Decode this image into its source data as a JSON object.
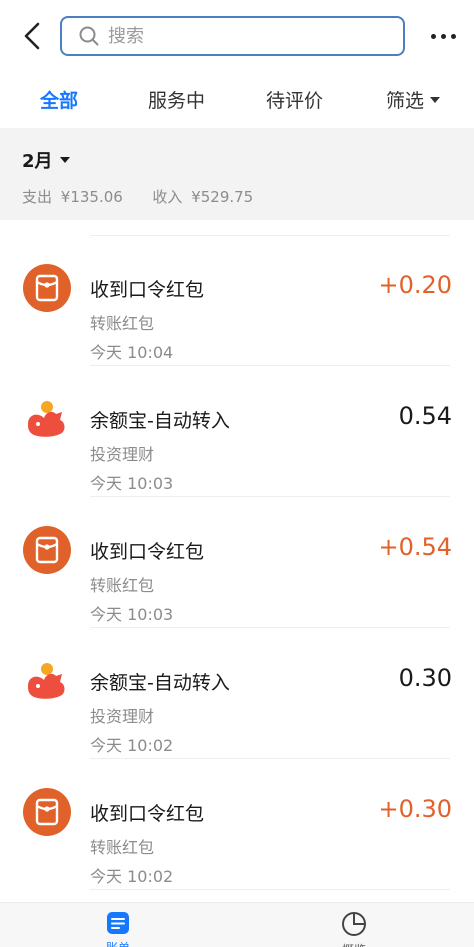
{
  "header": {
    "search_placeholder": "搜索"
  },
  "tabs": [
    {
      "label": "全部",
      "active": true
    },
    {
      "label": "服务中",
      "active": false
    },
    {
      "label": "待评价",
      "active": false
    },
    {
      "label": "筛选",
      "active": false
    }
  ],
  "summary": {
    "month": "2月",
    "expense_label": "支出",
    "expense_value": "¥135.06",
    "income_label": "收入",
    "income_value": "¥529.75"
  },
  "transactions": [
    {
      "icon": "red-packet-icon",
      "title": "收到口令红包",
      "category": "转账红包",
      "time": "今天  10:04",
      "amount": "+0.20",
      "amount_color": "#e0622a"
    },
    {
      "icon": "yuebao-icon",
      "title": "余额宝-自动转入",
      "category": "投资理财",
      "time": "今天  10:03",
      "amount": "0.54",
      "amount_color": "#1a1a1a"
    },
    {
      "icon": "red-packet-icon",
      "title": "收到口令红包",
      "category": "转账红包",
      "time": "今天  10:03",
      "amount": "+0.54",
      "amount_color": "#e0622a"
    },
    {
      "icon": "yuebao-icon",
      "title": "余额宝-自动转入",
      "category": "投资理财",
      "time": "今天  10:02",
      "amount": "0.30",
      "amount_color": "#1a1a1a"
    },
    {
      "icon": "red-packet-icon",
      "title": "收到口令红包",
      "category": "转账红包",
      "time": "今天  10:02",
      "amount": "+0.30",
      "amount_color": "#e0622a"
    }
  ],
  "bottom_nav": {
    "bill_label": "账单",
    "overview_label": "概览"
  },
  "colors": {
    "accent": "#1677ff",
    "income": "#e0622a",
    "search_border": "#4a7fc1"
  }
}
